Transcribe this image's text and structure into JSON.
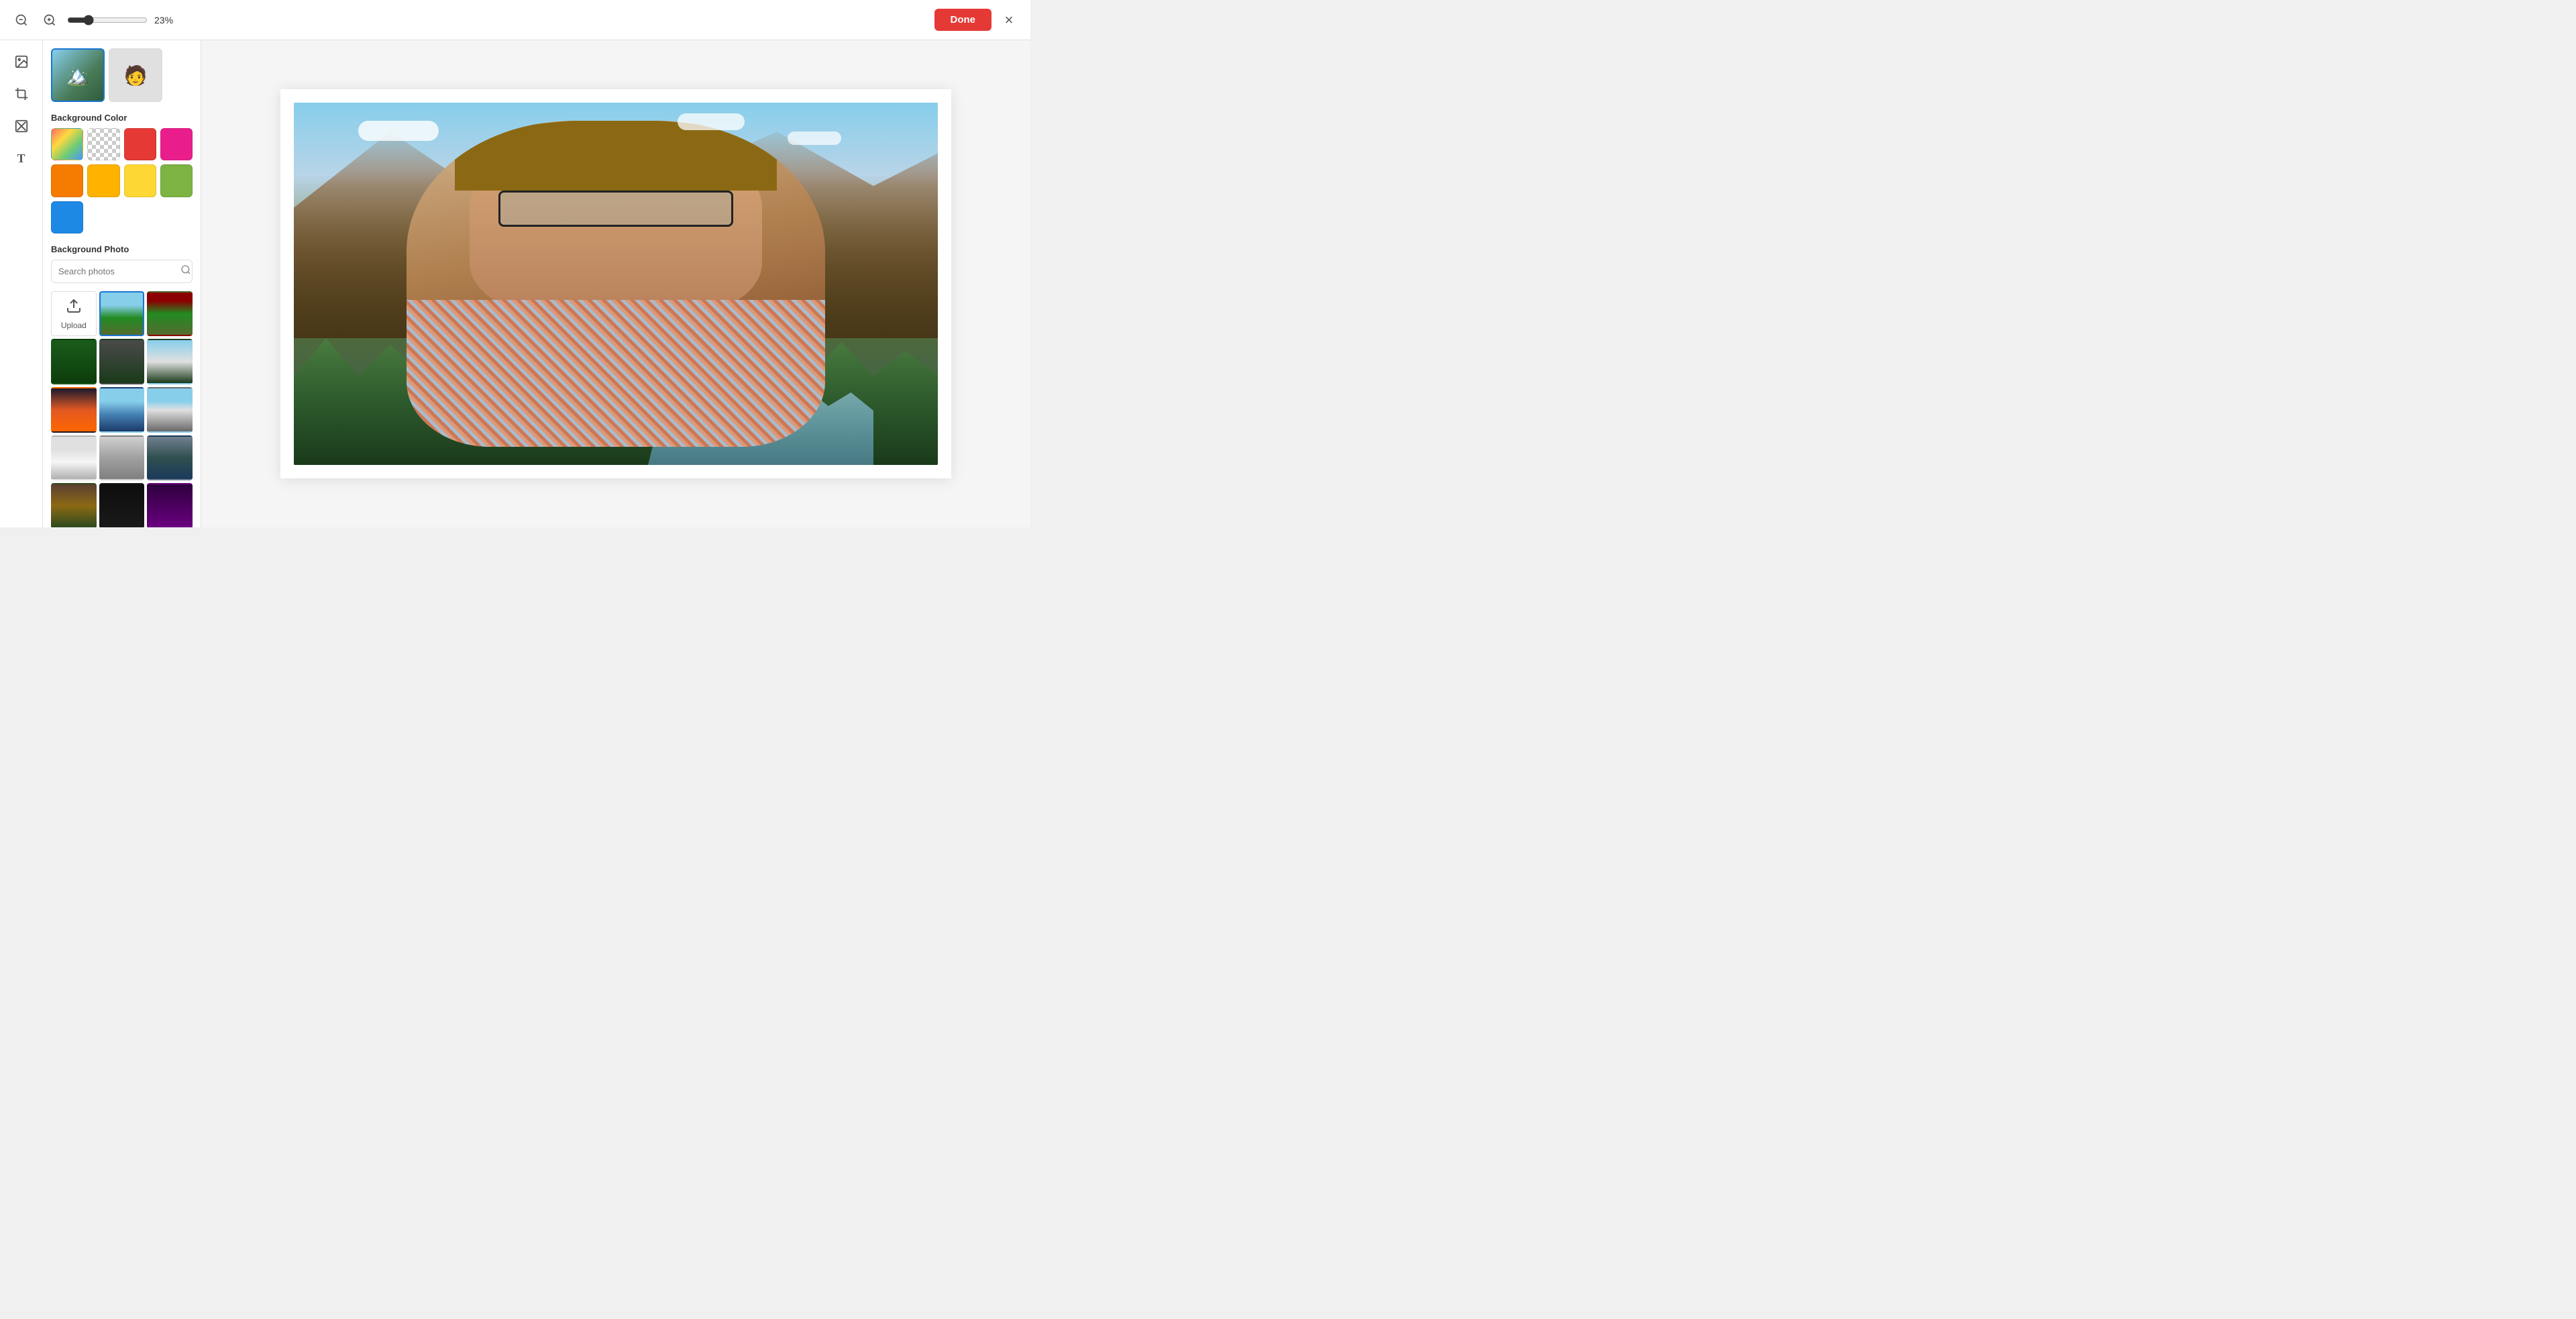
{
  "toolbar": {
    "zoom_value": "23%",
    "done_label": "Done",
    "close_label": "×"
  },
  "sidebar": {
    "background_color_label": "Background Color",
    "background_photo_label": "Background Photo",
    "search_placeholder": "Search photos",
    "upload_label": "Upload",
    "colors": [
      {
        "id": "gradient",
        "type": "gradient",
        "title": "Gradient"
      },
      {
        "id": "transparent",
        "type": "checker",
        "title": "Transparent"
      },
      {
        "id": "red",
        "value": "#e53935",
        "title": "Red"
      },
      {
        "id": "pink",
        "value": "#e91e8c",
        "title": "Pink"
      },
      {
        "id": "orange",
        "value": "#f57c00",
        "title": "Orange"
      },
      {
        "id": "amber",
        "value": "#ffb300",
        "title": "Amber"
      },
      {
        "id": "yellow",
        "value": "#fdd835",
        "title": "Yellow"
      },
      {
        "id": "green",
        "value": "#7cb342",
        "title": "Green"
      },
      {
        "id": "blue",
        "value": "#1e88e5",
        "title": "Blue"
      }
    ],
    "photos": [
      {
        "id": "photo-1",
        "class": "photo-nature-1",
        "selected": true
      },
      {
        "id": "photo-2",
        "class": "photo-nature-2",
        "selected": false
      },
      {
        "id": "photo-3",
        "class": "photo-forest-1",
        "selected": false
      },
      {
        "id": "photo-4",
        "class": "photo-forest-2",
        "selected": false
      },
      {
        "id": "photo-5",
        "class": "photo-sky-1",
        "selected": false
      },
      {
        "id": "photo-6",
        "class": "photo-fire-1",
        "selected": false
      },
      {
        "id": "photo-7",
        "class": "photo-lake-1",
        "selected": false
      },
      {
        "id": "photo-8",
        "class": "photo-mountain-1",
        "selected": false
      },
      {
        "id": "photo-9",
        "class": "photo-snow-1",
        "selected": false
      },
      {
        "id": "photo-10",
        "class": "photo-snow-2",
        "selected": false
      },
      {
        "id": "photo-11",
        "class": "photo-lake-2",
        "selected": false
      },
      {
        "id": "photo-12",
        "class": "photo-cabin-1",
        "selected": false
      },
      {
        "id": "photo-13",
        "class": "photo-dark-1",
        "selected": false
      },
      {
        "id": "photo-14",
        "class": "photo-purple-1",
        "selected": false
      },
      {
        "id": "photo-15",
        "class": "photo-green-1",
        "selected": false
      },
      {
        "id": "photo-16",
        "class": "photo-green-2",
        "selected": false
      },
      {
        "id": "photo-17",
        "class": "photo-dark-teal",
        "selected": false
      },
      {
        "id": "photo-18",
        "class": "photo-road-1",
        "selected": false
      },
      {
        "id": "photo-19",
        "class": "photo-valley-1",
        "selected": false
      }
    ],
    "tool_icons": [
      {
        "id": "image-tool",
        "symbol": "🖼",
        "label": "Image"
      },
      {
        "id": "crop-tool",
        "symbol": "⬛",
        "label": "Crop"
      },
      {
        "id": "erase-tool",
        "symbol": "✏",
        "label": "Erase"
      },
      {
        "id": "text-tool",
        "symbol": "T",
        "label": "Text"
      }
    ],
    "preview_thumbnails": [
      {
        "id": "thumb-1",
        "active": true
      },
      {
        "id": "thumb-2",
        "active": false
      }
    ]
  },
  "canvas": {
    "background": "Zion National Park landscape with person",
    "zoom": 23
  }
}
